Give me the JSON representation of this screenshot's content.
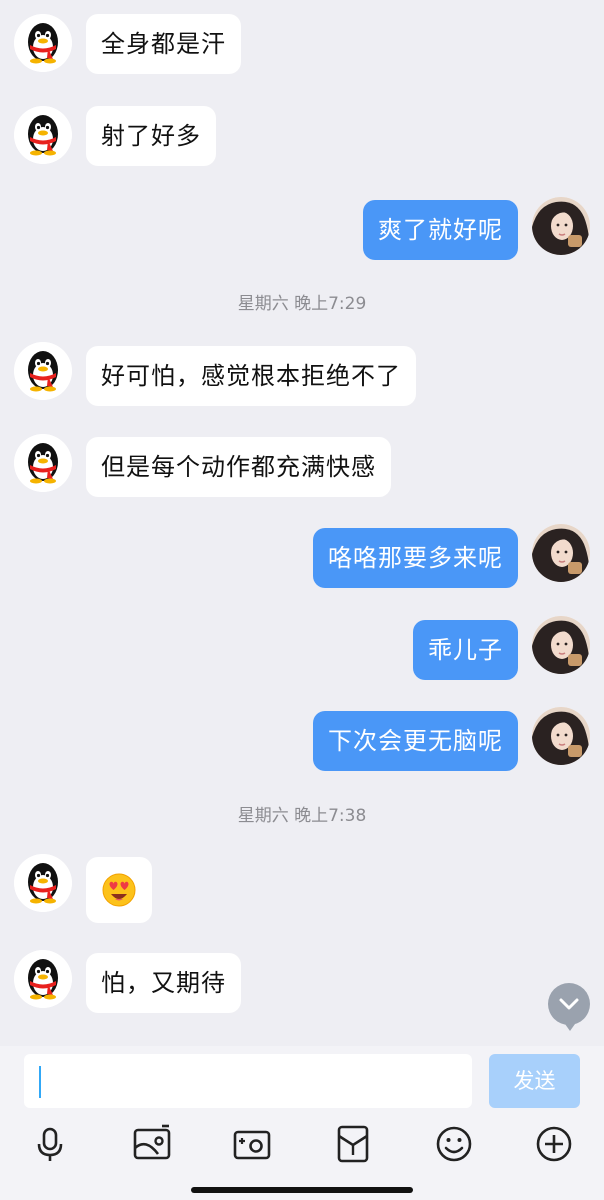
{
  "chat": {
    "messages": [
      {
        "side": "in",
        "text": "全身都是汗"
      },
      {
        "side": "in",
        "text": "射了好多"
      },
      {
        "side": "out",
        "text": "爽了就好呢"
      },
      {
        "timestamp": "星期六 晚上7:29"
      },
      {
        "side": "in",
        "text": "好可怕，感觉根本拒绝不了"
      },
      {
        "side": "in",
        "text": "但是每个动作都充满快感"
      },
      {
        "side": "out",
        "text": "咯咯那要多来呢"
      },
      {
        "side": "out",
        "text": "乖儿子"
      },
      {
        "side": "out",
        "text": "下次会更无脑呢"
      },
      {
        "timestamp": "星期六 晚上7:38"
      },
      {
        "side": "in",
        "type": "emoji",
        "icon": "heart-eyes-emoji"
      },
      {
        "side": "in",
        "text": "怕，又期待"
      }
    ]
  },
  "input": {
    "value": "",
    "send_label": "发送"
  },
  "toolbar": {
    "icons": [
      "microphone-icon",
      "image-icon",
      "camera-icon",
      "red-packet-icon",
      "emoji-icon",
      "plus-icon"
    ]
  },
  "colors": {
    "outgoing_bubble": "#4a97f7",
    "incoming_bubble": "#ffffff",
    "background": "#eeeef3",
    "send_button": "#a8d0fb"
  }
}
